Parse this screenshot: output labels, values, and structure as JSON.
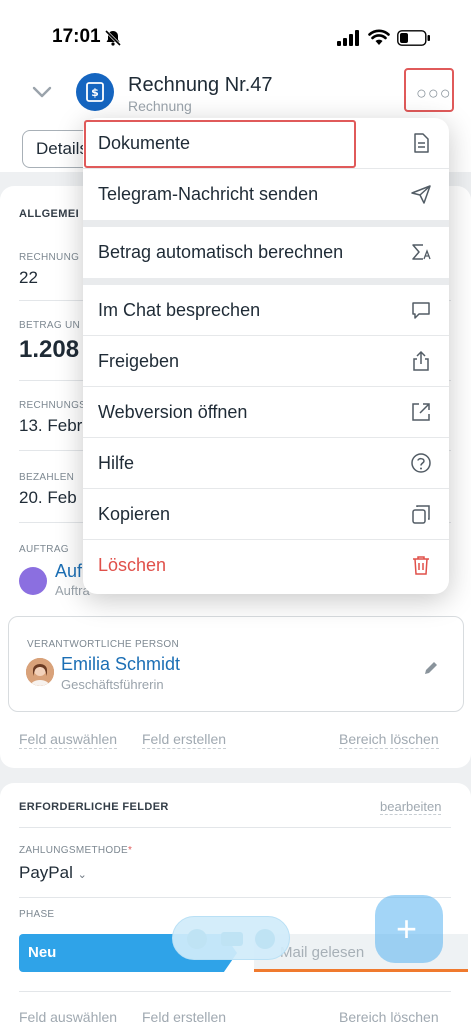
{
  "status_bar": {
    "time": "17:01"
  },
  "header": {
    "title": "Rechnung Nr.47",
    "subtitle": "Rechnung",
    "tab_label": "Details"
  },
  "general": {
    "title": "ALLGEMEI",
    "fields": [
      {
        "label": "RECHNUNG",
        "value": "22"
      },
      {
        "label": "BETRAG UN",
        "value": "1.208"
      },
      {
        "label": "RECHNUNGS",
        "value": "13. Febr"
      },
      {
        "label": "BEZAHLEN",
        "value": "20. Feb"
      }
    ],
    "order": {
      "label": "AUFTRAG",
      "link": "Auf",
      "sub": "Auftra"
    }
  },
  "person": {
    "label": "VERANTWORTLICHE PERSON",
    "name": "Emilia Schmidt",
    "role": "Geschäftsführerin"
  },
  "footer_links": {
    "select_field": "Feld auswählen",
    "create_field": "Feld erstellen",
    "clear_section": "Bereich löschen"
  },
  "required": {
    "title": "ERFORDERLICHE FELDER",
    "edit": "bearbeiten",
    "payment_label": "ZAHLUNGSMETHODE",
    "payment_star": "*",
    "payment_value": "PayPal",
    "phase_label": "PHASE",
    "phase_current": "Neu",
    "phase_next": "Mail gelesen"
  },
  "menu": {
    "items": [
      {
        "label": "Dokumente",
        "icon": "document-icon"
      },
      {
        "label": "Telegram-Nachricht senden",
        "icon": "send-icon"
      },
      {
        "label": "Betrag automatisch berechnen",
        "icon": "sum-icon"
      },
      {
        "label": "Im Chat besprechen",
        "icon": "chat-icon"
      },
      {
        "label": "Freigeben",
        "icon": "share-icon"
      },
      {
        "label": "Webversion öffnen",
        "icon": "external-link-icon"
      },
      {
        "label": "Hilfe",
        "icon": "help-icon"
      },
      {
        "label": "Kopieren",
        "icon": "copy-icon"
      },
      {
        "label": "Löschen",
        "icon": "trash-icon"
      }
    ]
  },
  "colors": {
    "accent_blue": "#1c6fb5",
    "danger": "#e0504a",
    "phase_new": "#2fa3e8",
    "highlight": "#e05a5a"
  }
}
